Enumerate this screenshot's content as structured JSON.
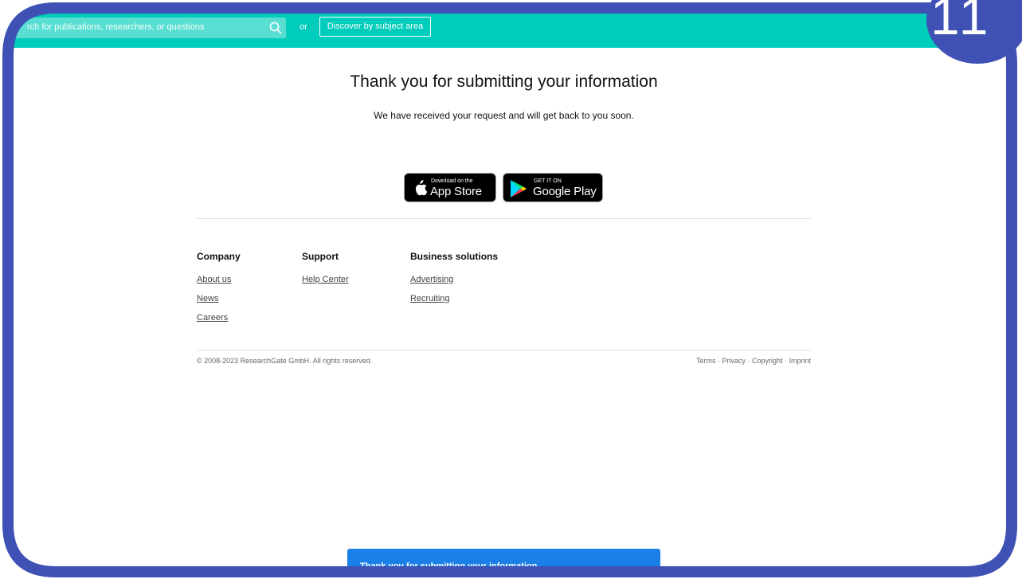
{
  "header": {
    "search_placeholder": "rch for publications, researchers, or questions",
    "or_label": "or",
    "discover_button": "Discover by subject area"
  },
  "main": {
    "title": "Thank you for submitting your information",
    "subtitle": "We have received your request and will get back to you soon."
  },
  "app_badges": {
    "apple": {
      "small": "Download on the",
      "big": "App Store"
    },
    "google": {
      "small": "GET IT ON",
      "big": "Google Play"
    }
  },
  "footer": {
    "columns": [
      {
        "heading": "Company",
        "links": [
          "About us",
          "News",
          "Careers"
        ]
      },
      {
        "heading": "Support",
        "links": [
          "Help Center"
        ]
      },
      {
        "heading": "Business solutions",
        "links": [
          "Advertising",
          "Recruiting"
        ]
      }
    ],
    "copyright": "© 2008-2023 ResearchGate GmbH. All rights reserved.",
    "legal": "Terms · Privacy · Copyright · Imprint"
  },
  "toast": {
    "message": "Thank you for submitting your information"
  },
  "step_badge": "11",
  "colors": {
    "header": "#00ccbb",
    "frame": "#3f51b5",
    "toast": "#1a7fe6"
  }
}
